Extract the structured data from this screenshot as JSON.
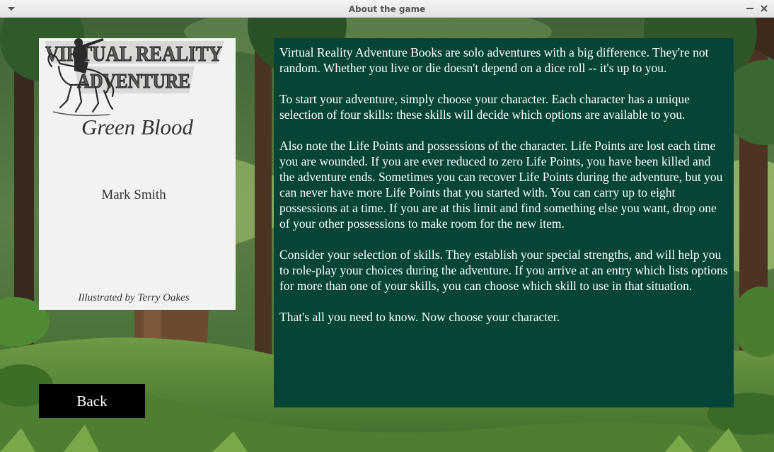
{
  "window": {
    "title": "About the game"
  },
  "cover": {
    "logo_line1": "VIRTUAL REALITY",
    "logo_line2": "ADVENTURE",
    "title": "Green Blood",
    "author": "Mark Smith",
    "illustrator": "Illustrated by Terry Oakes"
  },
  "about": {
    "paragraphs": [
      "Virtual Reality Adventure Books are solo adventures with a big difference. They're not random. Whether you live or die doesn't depend on a dice roll -- it's up to you.",
      "To start your adventure, simply choose your character. Each character has a unique selection of four skills: these skills will decide which options are available to you.",
      "Also note the Life Points and possessions of the character. Life Points are lost each time you are wounded. If you are ever reduced to zero Life Points, you have been killed and the adventure ends. Sometimes you can recover Life Points during the adventure, but you can never have more Life Points that you started with. You can carry up to eight possessions at a time. If you are at this limit and find something else you want, drop one of your other possessions to make room for the new item.",
      "Consider your selection of skills. They establish your special strengths, and will help you to role-play your choices during the adventure. If you arrive at an entry which lists options for more than one of your skills, you can choose which skill to use in that situation.",
      "That's all you need to know. Now choose your character."
    ]
  },
  "buttons": {
    "back_label": "Back"
  },
  "colors": {
    "panel_bg": "#064438",
    "back_bg": "#000000",
    "forest_dark": "#2f4d2c",
    "forest_light": "#8fb45e"
  },
  "icons": {
    "menu": "chevron-down-icon",
    "minimize": "minimize-icon",
    "close": "close-icon"
  }
}
